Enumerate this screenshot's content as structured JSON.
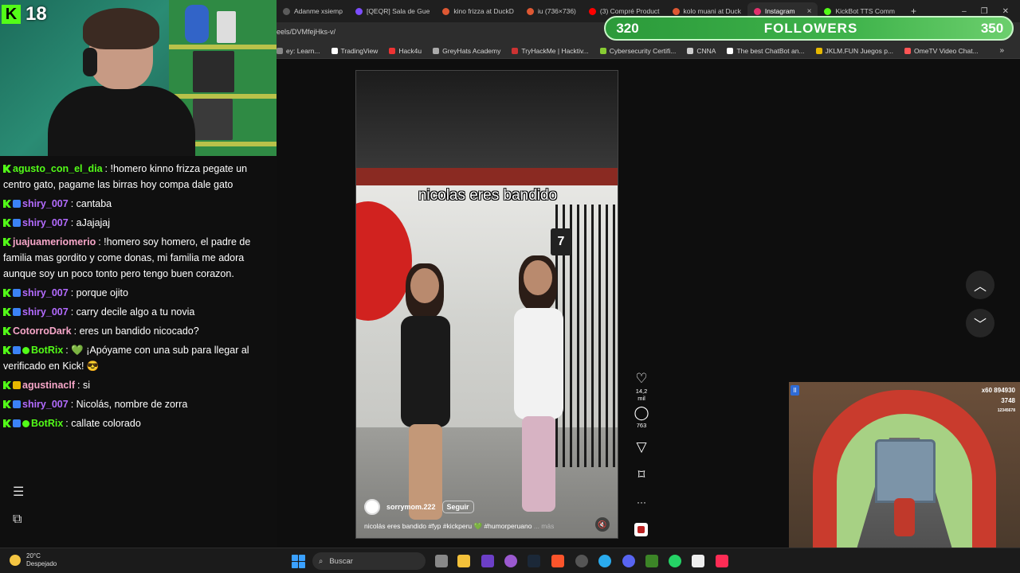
{
  "browser": {
    "tabs": [
      {
        "label": "Adanme xsiemp",
        "color": "#5b5b5b"
      },
      {
        "label": "[QEQR] Sala de Gue",
        "color": "#7c4dff"
      },
      {
        "label": "kino frizza at DuckD",
        "color": "#de5833"
      },
      {
        "label": "iu (736×736)",
        "color": "#de5833"
      },
      {
        "label": "(3) Compré Product",
        "color": "#ff0000"
      },
      {
        "label": "kolo muani at Duck",
        "color": "#de5833"
      },
      {
        "label": "Instagram",
        "color": "#e1306c",
        "active": true
      },
      {
        "label": "KickBot TTS Comm",
        "color": "#53fc18"
      }
    ],
    "tab_close": "×",
    "new_tab": "+",
    "window_controls": [
      "–",
      "❐",
      "✕"
    ],
    "url": "eels/DVMfejHks-v/",
    "bookmarks": [
      {
        "label": "ey: Learn...",
        "color": "#888"
      },
      {
        "label": "TradingView",
        "color": "#fff"
      },
      {
        "label": "Hack4u",
        "color": "#e33"
      },
      {
        "label": "GreyHats Academy",
        "color": "#aaa"
      },
      {
        "label": "TryHackMe | Hacktiv...",
        "color": "#c33"
      },
      {
        "label": "Cybersecurity Certifi...",
        "color": "#8c3"
      },
      {
        "label": "CNNA",
        "color": "#ccc"
      },
      {
        "label": "The best ChatBot an...",
        "color": "#fff"
      },
      {
        "label": "JKLM.FUN Juegos p...",
        "color": "#e6b800"
      },
      {
        "label": "OmeTV Video Chat...",
        "color": "#f55"
      }
    ],
    "bookmarks_more": "»"
  },
  "followers_bar": {
    "current": "320",
    "title": "FOLLOWERS",
    "goal": "350",
    "accent": "#3fb34b"
  },
  "stream": {
    "viewer_count": "18",
    "kick_logo": "K",
    "chat": [
      {
        "badges": [
          "k"
        ],
        "user": "agusto_con_el_dia",
        "color": "#53fc18",
        "text": ": !homero kinno frizza pegate un centro gato, pagame las birras hoy compa dale gato"
      },
      {
        "badges": [
          "k",
          "s"
        ],
        "user": "shiry_007",
        "color": "#b36bff",
        "text": ": cantaba"
      },
      {
        "badges": [
          "k",
          "s"
        ],
        "user": "shiry_007",
        "color": "#b36bff",
        "text": ": aJajajaj"
      },
      {
        "badges": [
          "k"
        ],
        "user": "juajuameriomerio",
        "color": "#f6a6c8",
        "text": ": !homero soy homero, el padre de familia mas gordito y come donas, mi familia me adora aunque soy un poco tonto pero tengo buen corazon."
      },
      {
        "badges": [
          "k",
          "s"
        ],
        "user": "shiry_007",
        "color": "#b36bff",
        "text": ": porque ojito"
      },
      {
        "badges": [
          "k",
          "s"
        ],
        "user": "shiry_007",
        "color": "#b36bff",
        "text": ": carry decile algo a tu novia"
      },
      {
        "badges": [
          "k"
        ],
        "user": "CotorroDark",
        "color": "#f6a6c8",
        "text": ": eres un bandido nicocado?"
      },
      {
        "badges": [
          "k",
          "s",
          "v"
        ],
        "user": "BotRix",
        "color": "#53fc18",
        "text": ": 💚 ¡Apóyame con una sub para llegar al verificado en Kick! 😎"
      },
      {
        "badges": [
          "k",
          "g"
        ],
        "user": "agustinaclf",
        "color": "#f6a6c8",
        "text": ": si"
      },
      {
        "badges": [
          "k",
          "s"
        ],
        "user": "shiry_007",
        "color": "#b36bff",
        "text": ": Nicolás, nombre de zorra"
      },
      {
        "badges": [
          "k",
          "s",
          "v"
        ],
        "user": "BotRix",
        "color": "#53fc18",
        "text": ": callate colorado"
      }
    ],
    "side_icons": [
      "menu-icon",
      "sitemap-icon"
    ]
  },
  "reel": {
    "caption": "nicolas eres bandido",
    "sign_number": "7",
    "username": "sorrymom.222",
    "follow_label": "Seguir",
    "description": "nicolás eres bandido #fyp #kickperu 💚 #humorperuano",
    "more_label": "... más",
    "likes": "14,2 mil",
    "comments": "763",
    "mute_icon": "🔇"
  },
  "nav": {
    "up_icon": "chevron-up-icon",
    "down_icon": "chevron-down-icon"
  },
  "game": {
    "score_line1": "x60 894930",
    "score_line2": "3748",
    "score_line3": "12345678",
    "pause_icon": "II"
  },
  "taskbar": {
    "temperature": "20°C",
    "weather": "Despejado",
    "search_placeholder": "Buscar"
  }
}
